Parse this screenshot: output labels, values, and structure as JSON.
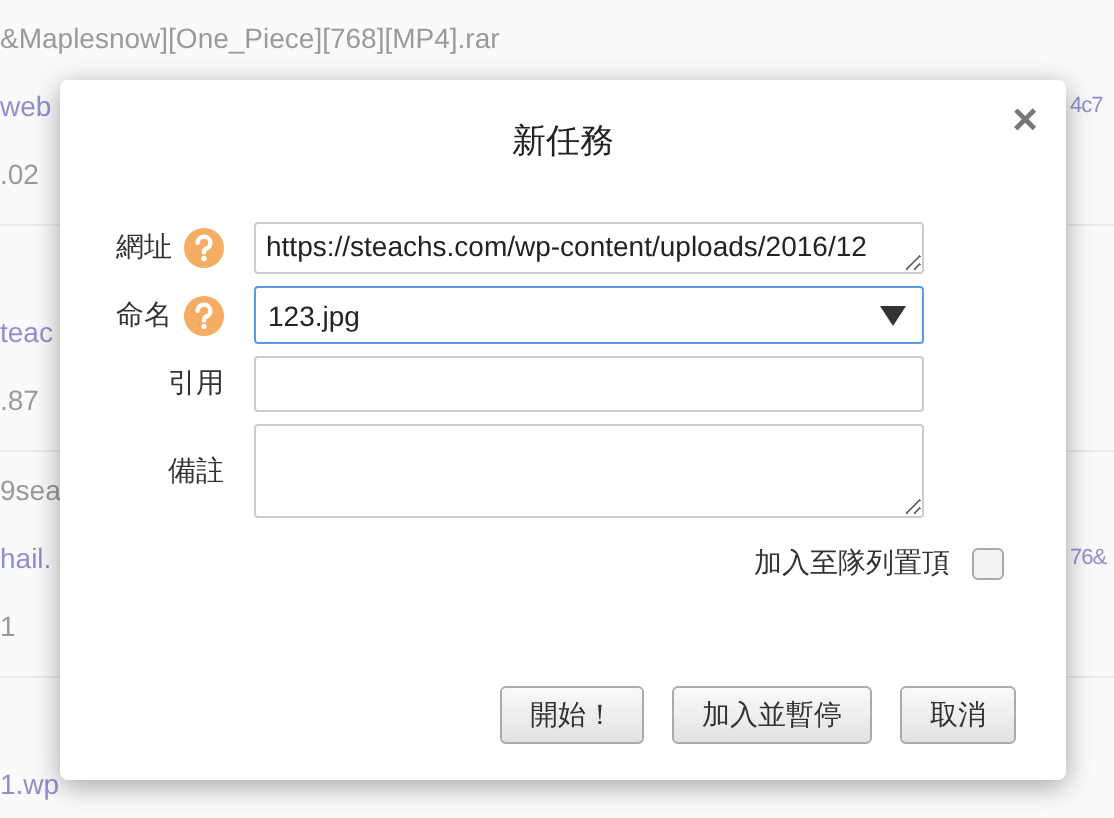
{
  "background_list": [
    {
      "name": "&Maplesnow][One_Piece][768][MP4].rar",
      "link": "web",
      "link_right": "4c7",
      "size": ".02"
    },
    {
      "link": "teac",
      "size": ".87"
    },
    {
      "name": "9sea",
      "link": "hail.",
      "link_right": "76&",
      "size": "1"
    },
    {
      "link": "1.wp"
    }
  ],
  "dialog": {
    "title": "新任務",
    "close": "×",
    "fields": [
      {
        "label": "網址",
        "help": true,
        "kind": "textarea_line",
        "value": "https://steachs.com/wp-content/uploads/2016/12",
        "focused": false
      },
      {
        "label": "命名",
        "help": true,
        "kind": "combo",
        "value": "123.jpg",
        "focused": true
      },
      {
        "label": "引用",
        "help": false,
        "kind": "text",
        "focused": false
      },
      {
        "label": "備註",
        "help": false,
        "kind": "textarea",
        "focused": false
      }
    ],
    "top_of_queue": {
      "label": "加入至隊列置頂",
      "checked": false
    },
    "buttons": [
      "開始！",
      "加入並暫停",
      "取消"
    ]
  }
}
